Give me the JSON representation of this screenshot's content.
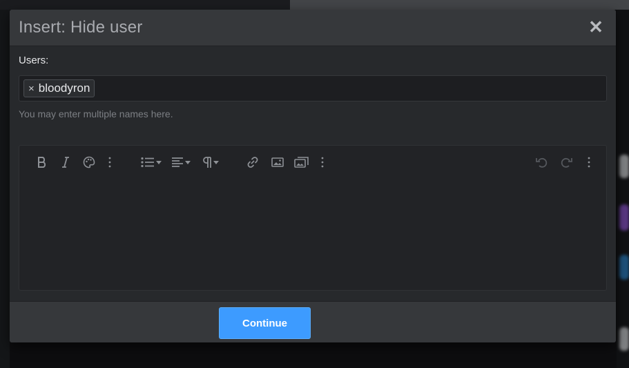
{
  "dialog": {
    "title": "Insert: Hide user",
    "close_symbol": "✕"
  },
  "users_field": {
    "label": "Users:",
    "tokens": [
      {
        "remove_symbol": "×",
        "name": "bloodyron"
      }
    ],
    "hint": "You may enter multiple names here."
  },
  "editor": {
    "toolbar": [
      {
        "name": "bold-icon"
      },
      {
        "name": "italic-icon"
      },
      {
        "name": "palette-icon"
      },
      {
        "name": "more-text-icon"
      },
      {
        "name": "list-icon"
      },
      {
        "name": "align-icon"
      },
      {
        "name": "paragraph-icon"
      },
      {
        "name": "link-icon"
      },
      {
        "name": "image-icon"
      },
      {
        "name": "media-gallery-icon"
      },
      {
        "name": "more-insert-icon"
      },
      {
        "name": "undo-icon"
      },
      {
        "name": "redo-icon"
      },
      {
        "name": "more-options-icon"
      }
    ],
    "content": ""
  },
  "footer": {
    "continue_label": "Continue"
  },
  "colors": {
    "primary_button": "#3d9bff",
    "modal_bg": "#27292c",
    "header_bg": "#36383b"
  }
}
